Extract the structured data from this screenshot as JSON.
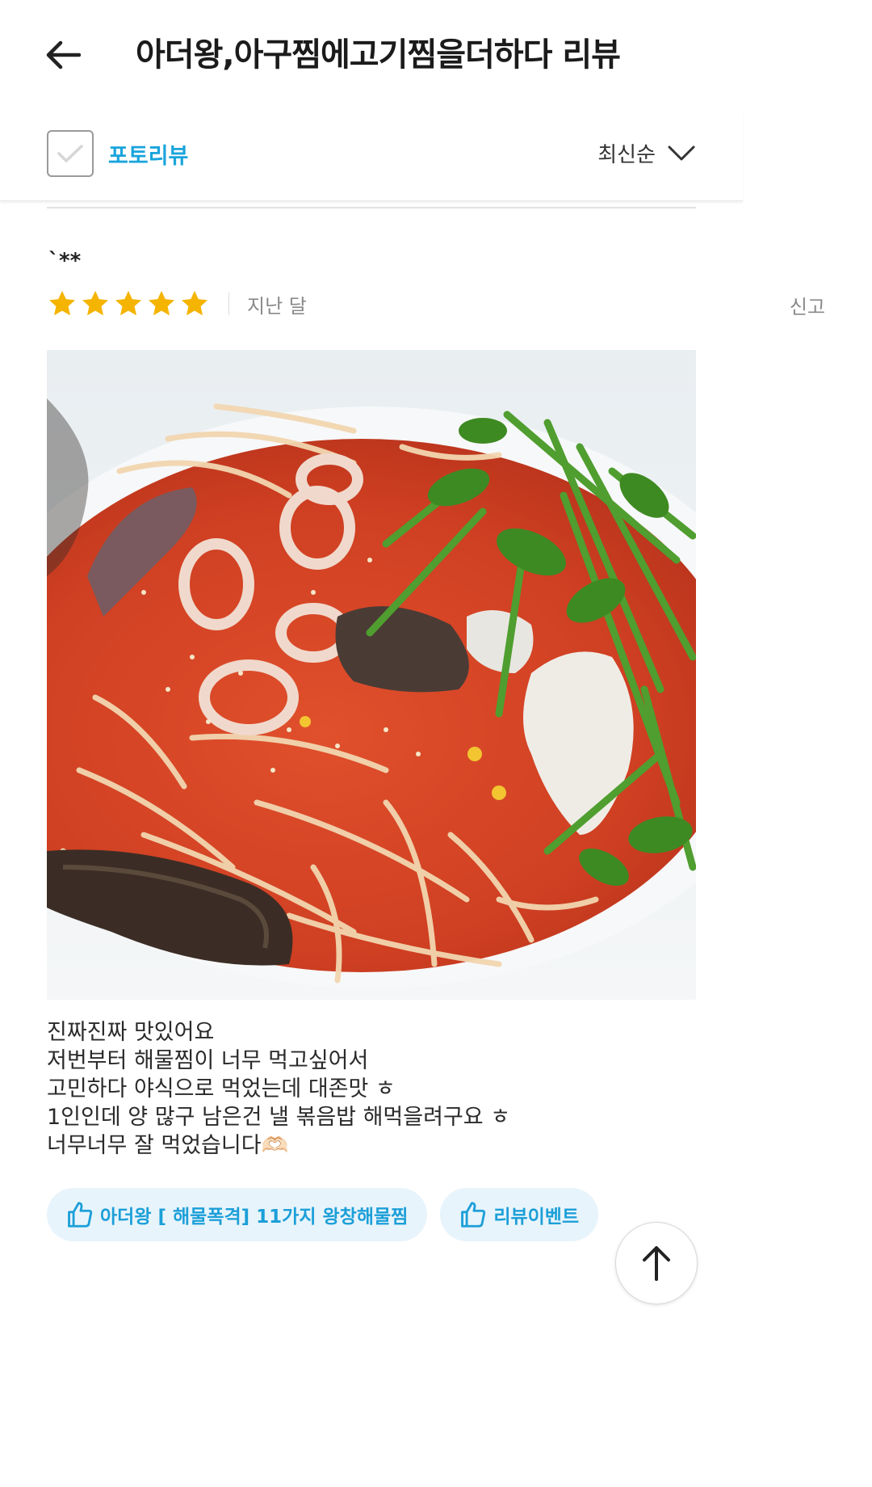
{
  "header": {
    "title": "아더왕,아구찜에고기찜을더하다 리뷰",
    "back_icon": "arrow-left-icon"
  },
  "filters": {
    "photo_review_label": "포토리뷰",
    "photo_review_checked": false,
    "sort_label": "최신순",
    "sort_icon": "chevron-down-icon"
  },
  "review": {
    "reviewer": "`**",
    "rating": 5,
    "rating_max": 5,
    "date": "지난 달",
    "report_label": "신고",
    "photo_alt": "해물찜 사진",
    "lines": [
      "진짜진짜 맛있어요",
      "저번부터 해물찜이 너무 먹고싶어서",
      "고민하다 야식으로 먹었는데 대존맛 ㅎ",
      "1인인데 양 많구 남은건 낼 볶음밥 해먹을려구요 ㅎ",
      "너무너무 잘 먹었습니다🫶🏻"
    ],
    "tags": [
      {
        "label": "아더왕 [ 해물폭격] 11가지 왕창해물찜",
        "icon": "thumbs-up-icon"
      },
      {
        "label": "리뷰이벤트",
        "icon": "thumbs-up-icon"
      }
    ]
  },
  "scroll_top_icon": "arrow-up-icon",
  "colors": {
    "accent": "#1aa4dc",
    "star": "#f5b400",
    "tag_bg": "#e8f4fb"
  }
}
